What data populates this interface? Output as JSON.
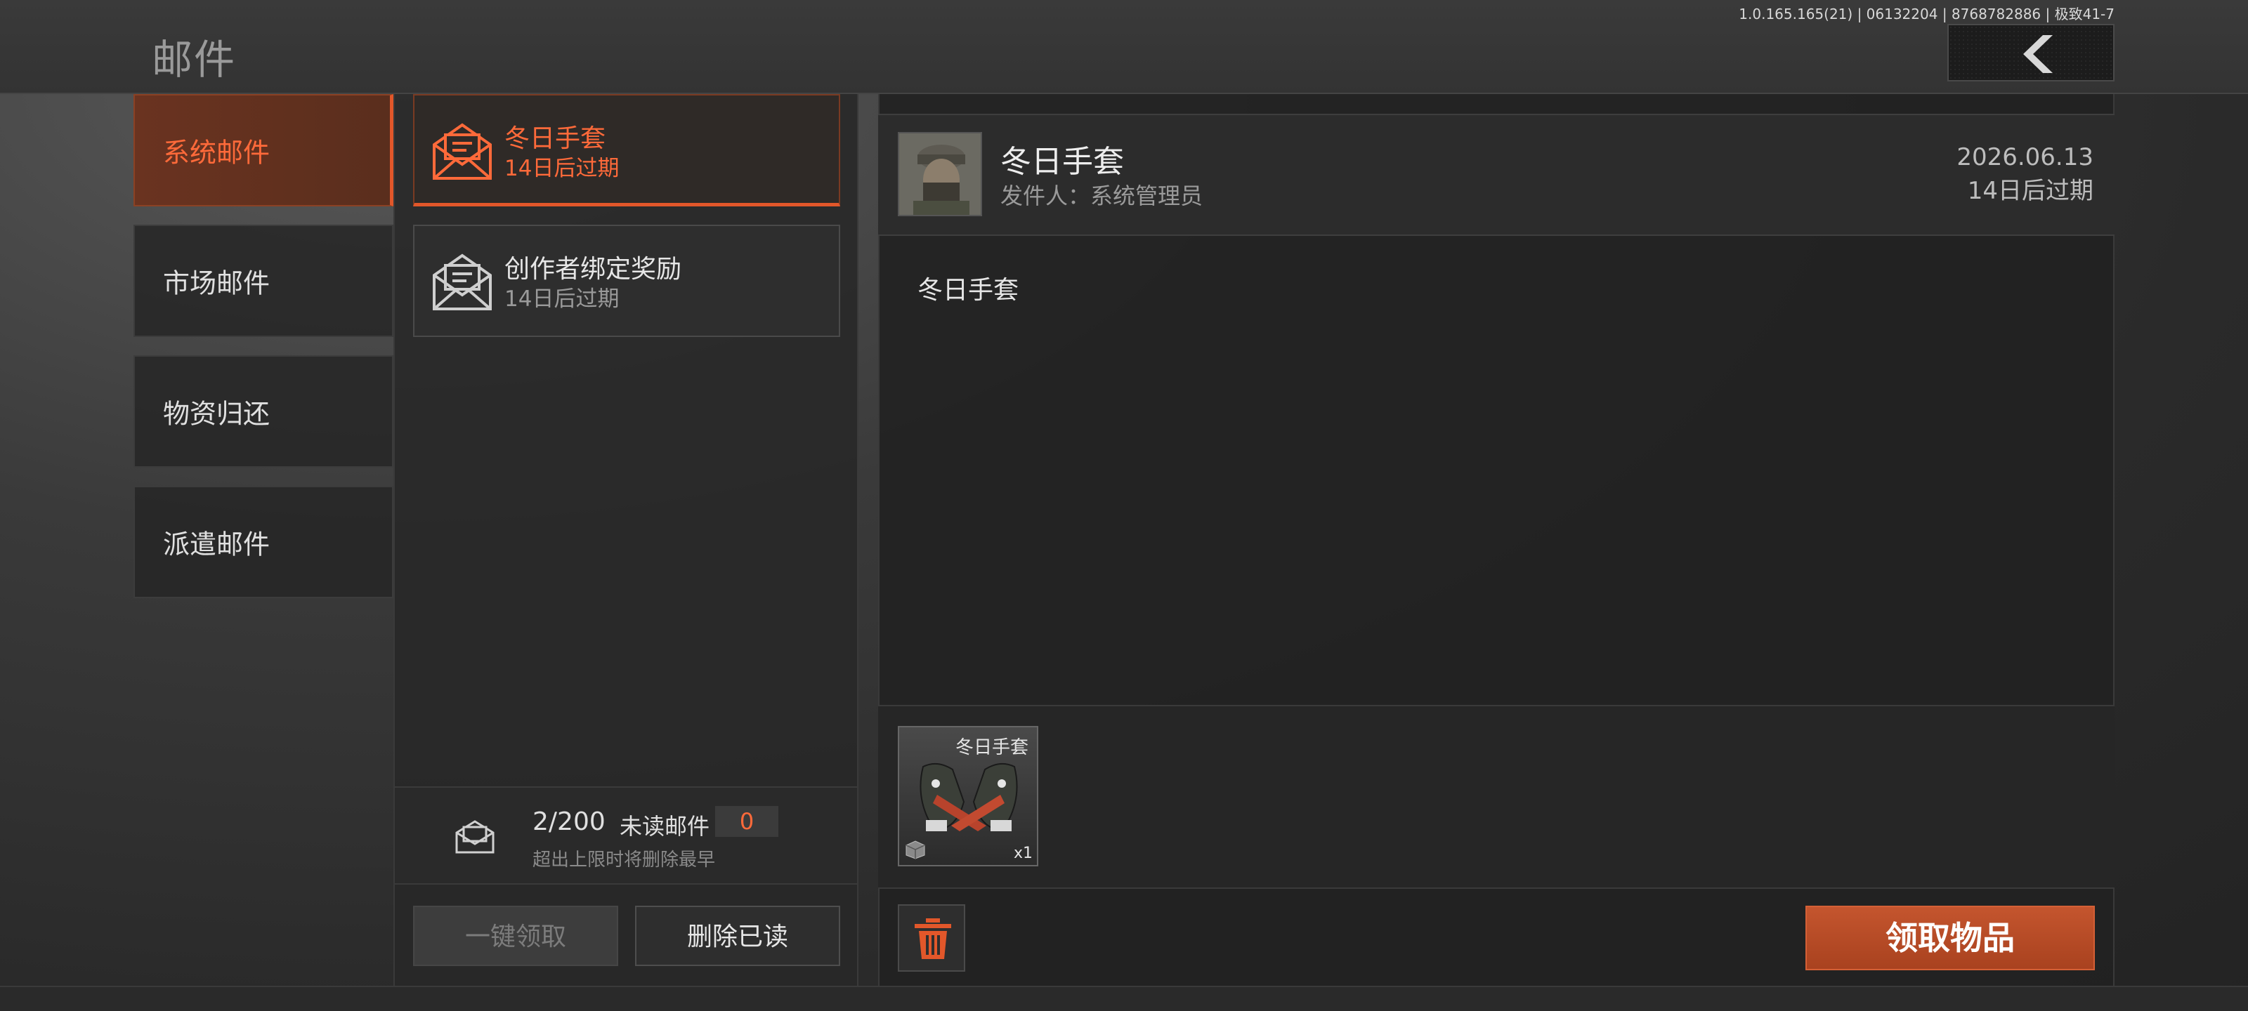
{
  "header": {
    "title": "邮件",
    "build_info": "1.0.165.165(21) | 06132204 | 8768782886 | 极致41-7"
  },
  "categories": [
    {
      "label": "系统邮件",
      "active": true
    },
    {
      "label": "市场邮件",
      "active": false
    },
    {
      "label": "物资归还",
      "active": false
    },
    {
      "label": "派遣邮件",
      "active": false
    }
  ],
  "mails": [
    {
      "title": "冬日手套",
      "expiry": "14日后过期",
      "active": true
    },
    {
      "title": "创作者绑定奖励",
      "expiry": "14日后过期",
      "active": false
    }
  ],
  "counter": {
    "count": "2/200",
    "unread_label": "未读邮件",
    "unread_value": "0",
    "note": "超出上限时将删除最早"
  },
  "buttons": {
    "claim_all": "一键领取",
    "delete_read": "删除已读",
    "take_items": "领取物品"
  },
  "detail": {
    "title": "冬日手套",
    "sender": "发件人：系统管理员",
    "date": "2026.06.13",
    "expiry": "14日后过期",
    "body": "冬日手套",
    "attachment": {
      "name": "冬日手套",
      "quantity": "x1"
    }
  },
  "colors": {
    "accent": "#e2572a",
    "accent_text": "#ff6a3a",
    "button_orange": "#b84a25"
  }
}
